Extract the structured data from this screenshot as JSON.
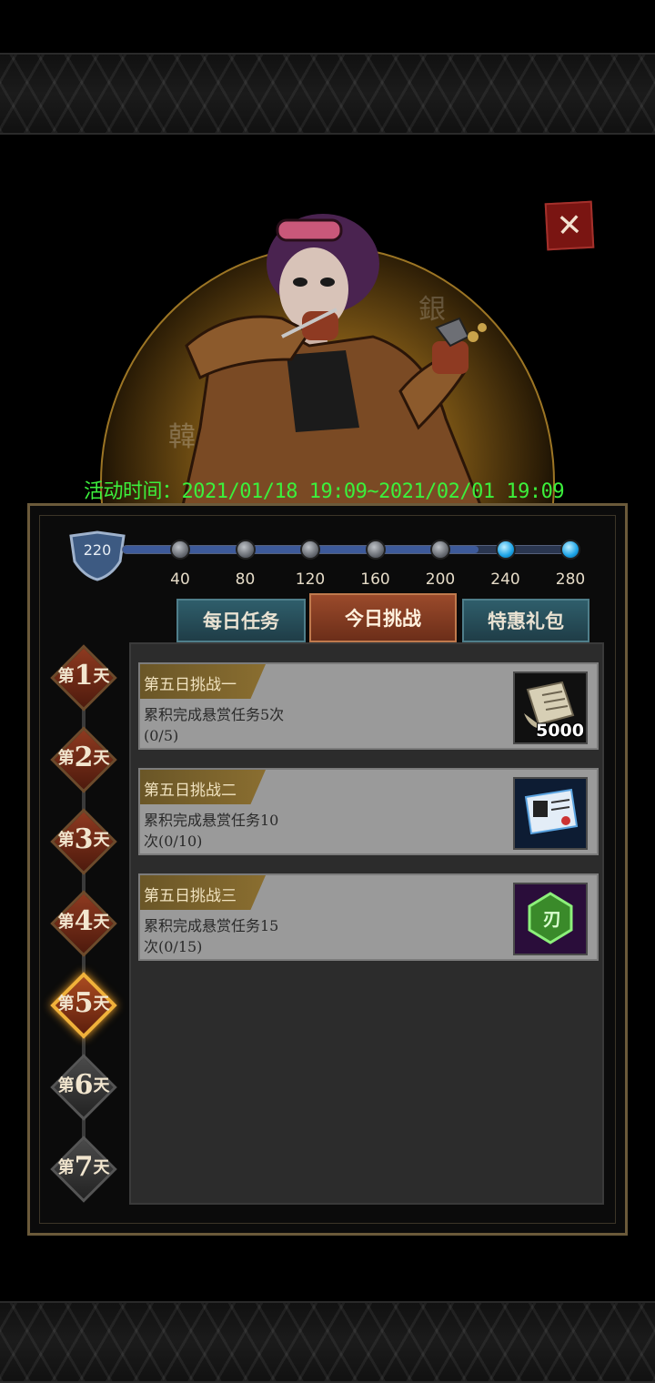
{
  "event_time": "活动时间：2021/01/18 19:09~2021/02/01 19:09",
  "progress": {
    "current_points": "220",
    "max_points": 280,
    "milestones": [
      {
        "value": "40",
        "reached": false
      },
      {
        "value": "80",
        "reached": false
      },
      {
        "value": "120",
        "reached": false
      },
      {
        "value": "160",
        "reached": false
      },
      {
        "value": "200",
        "reached": false
      },
      {
        "value": "240",
        "reached": true
      },
      {
        "value": "280",
        "reached": true
      }
    ]
  },
  "tabs": [
    {
      "label": "每日任务",
      "active": false
    },
    {
      "label": "今日挑战",
      "active": true
    },
    {
      "label": "特惠礼包",
      "active": false
    }
  ],
  "days": [
    {
      "pre": "第",
      "num": "1",
      "post": "天",
      "state": "available"
    },
    {
      "pre": "第",
      "num": "2",
      "post": "天",
      "state": "available"
    },
    {
      "pre": "第",
      "num": "3",
      "post": "天",
      "state": "available"
    },
    {
      "pre": "第",
      "num": "4",
      "post": "天",
      "state": "available"
    },
    {
      "pre": "第",
      "num": "5",
      "post": "天",
      "state": "active"
    },
    {
      "pre": "第",
      "num": "6",
      "post": "天",
      "state": "locked"
    },
    {
      "pre": "第",
      "num": "7",
      "post": "天",
      "state": "locked"
    }
  ],
  "tasks": [
    {
      "title": "第五日挑战一",
      "desc_line1": "累积完成悬赏任务5次",
      "desc_line2": "(0/5)",
      "reward_icon": "scroll-icon",
      "reward_amount": "5000"
    },
    {
      "title": "第五日挑战二",
      "desc_line1": "累积完成悬赏任务10",
      "desc_line2": "次(0/10)",
      "reward_icon": "id-card-icon",
      "reward_amount": ""
    },
    {
      "title": "第五日挑战三",
      "desc_line1": "累积完成悬赏任务15",
      "desc_line2": "次(0/15)",
      "reward_icon": "green-gem-icon",
      "reward_amount": ""
    }
  ],
  "close_icon": "close-icon",
  "colors": {
    "event_time": "#3cf03c",
    "accent_gold": "#f0b13a",
    "tab_active": "#9a4a2b",
    "tab_inactive": "#2f5e6b",
    "node_lit": "#1aa2e6"
  }
}
